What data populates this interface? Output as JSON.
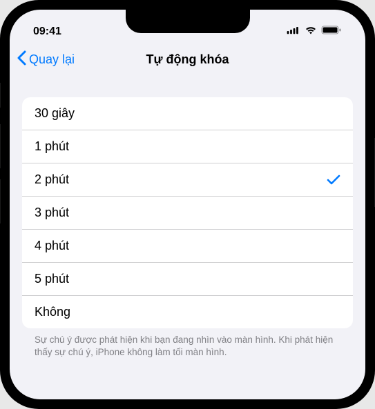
{
  "colors": {
    "accent": "#007aff",
    "background": "#f2f2f7",
    "cell_background": "#ffffff",
    "secondary_text": "#808085"
  },
  "status_bar": {
    "time": "09:41"
  },
  "nav": {
    "back_label": "Quay lại",
    "title": "Tự động khóa"
  },
  "options": [
    {
      "label": "30 giây",
      "selected": false
    },
    {
      "label": "1 phút",
      "selected": false
    },
    {
      "label": "2 phút",
      "selected": true
    },
    {
      "label": "3 phút",
      "selected": false
    },
    {
      "label": "4 phút",
      "selected": false
    },
    {
      "label": "5 phút",
      "selected": false
    },
    {
      "label": "Không",
      "selected": false
    }
  ],
  "footer": {
    "text": "Sự chú ý được phát hiện khi bạn đang nhìn vào màn hình. Khi phát hiện thấy sự chú ý, iPhone không làm tối màn hình."
  }
}
